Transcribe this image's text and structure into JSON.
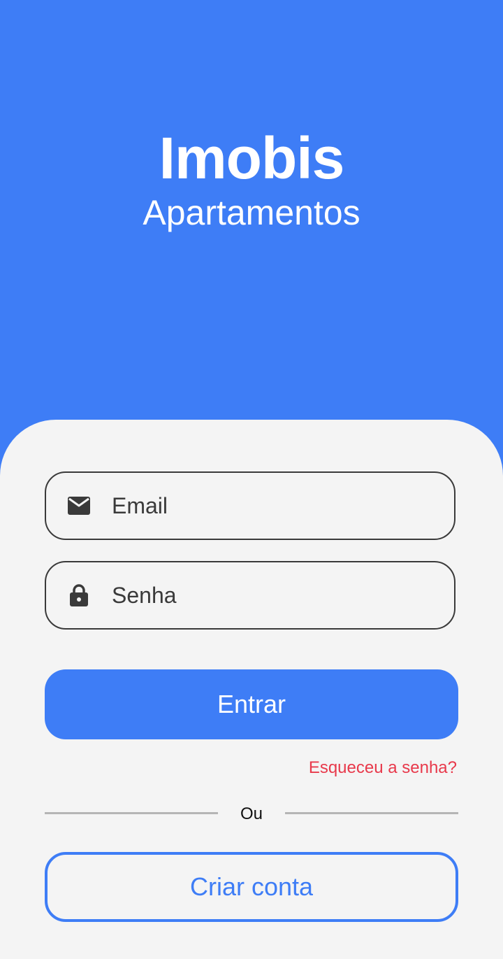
{
  "brand": {
    "title": "Imobis",
    "subtitle": "Apartamentos"
  },
  "form": {
    "email": {
      "placeholder": "Email",
      "value": "",
      "icon": "mail-icon"
    },
    "password": {
      "placeholder": "Senha",
      "value": "",
      "icon": "lock-icon"
    },
    "login_label": "Entrar",
    "forgot_label": "Esqueceu a senha?",
    "divider_label": "Ou",
    "create_account_label": "Criar conta"
  },
  "colors": {
    "primary": "#3e7df6",
    "background": "#f4f4f4",
    "danger": "#e8394b",
    "field_border": "#3a3a3a",
    "divider": "#b5b5b5"
  }
}
